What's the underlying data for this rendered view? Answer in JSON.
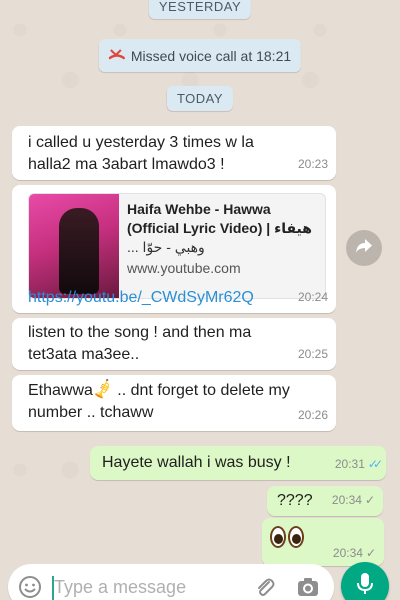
{
  "colors": {
    "background": "#e6ddd4",
    "incoming_bubble": "#ffffff",
    "outgoing_bubble": "#dcf8c6",
    "date_chip": "#dbe9f3",
    "link": "#2a8fd6",
    "read_ticks": "#4fb6ec",
    "missed_call_icon": "#e0463c",
    "mic_button": "#00a884"
  },
  "dates": {
    "yesterday": "YESTERDAY",
    "today": "TODAY"
  },
  "system": {
    "missed_call_text": "Missed voice call at 18:21",
    "missed_call_icon": "missed-call-icon"
  },
  "messages": [
    {
      "text": "i called u yesterday 3 times w la halla2 ma 3abart lmawdo3 !",
      "time": "20:23"
    },
    {
      "card_title": "Haifa Wehbe - Hawwa",
      "card_title2": "(Official Lyric Video) | هيفاء",
      "card_title3": "وهبي - حوّا ...",
      "card_host": "www.youtube.com",
      "link": "https://youtu.be/_CWdSyMr62Q",
      "time": "20:24"
    },
    {
      "text": "listen to the song ! and then ma tet3ata ma3ee..",
      "time": "20:25"
    },
    {
      "text_before": "Ethawwa",
      "text_after": " .. dnt forget to delete my number .. tchaww",
      "time": "20:26"
    },
    {
      "text": "Hayete  wallah i was busy !",
      "time": "20:31",
      "status": "read"
    },
    {
      "text": "????",
      "time": "20:34",
      "status": "sent"
    },
    {
      "time": "20:34",
      "status": "sent"
    }
  ],
  "composer": {
    "placeholder": "Type a message",
    "icons": [
      "emoji-icon",
      "attach-icon",
      "camera-icon",
      "mic-icon"
    ]
  }
}
